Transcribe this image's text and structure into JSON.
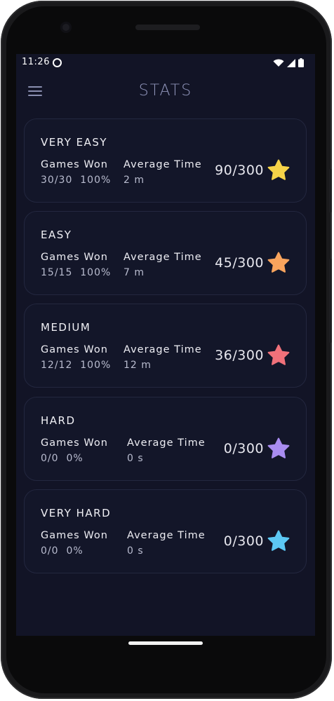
{
  "status": {
    "time": "11:26"
  },
  "header": {
    "title": "STATS"
  },
  "labels": {
    "games_won": "Games Won",
    "average_time": "Average Time"
  },
  "cards": [
    {
      "level": "VERY EASY",
      "games": "30/30",
      "pct": "100%",
      "avg": "2 m",
      "score": "90/300",
      "star_color": "#f6d348"
    },
    {
      "level": "EASY",
      "games": "15/15",
      "pct": "100%",
      "avg": "7 m",
      "score": "45/300",
      "star_color": "#f9a45d"
    },
    {
      "level": "MEDIUM",
      "games": "12/12",
      "pct": "100%",
      "avg": "12 m",
      "score": "36/300",
      "star_color": "#f0717a"
    },
    {
      "level": "HARD",
      "games": "0/0",
      "pct": "0%",
      "avg": "0 s",
      "score": "0/300",
      "star_color": "#a88cf0"
    },
    {
      "level": "VERY HARD",
      "games": "0/0",
      "pct": "0%",
      "avg": "0 s",
      "score": "0/300",
      "star_color": "#5cc8f4"
    }
  ]
}
